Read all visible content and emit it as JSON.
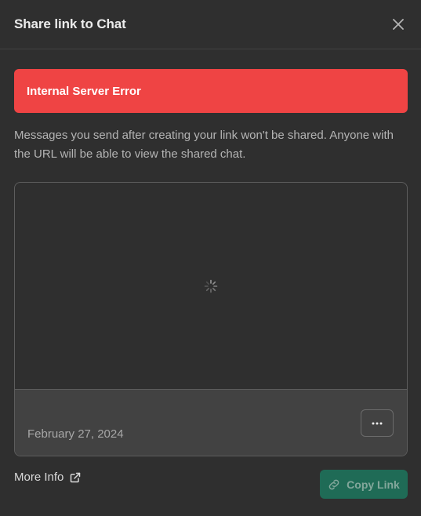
{
  "dialog": {
    "title": "Share link to Chat",
    "close_icon": "close-icon"
  },
  "error": {
    "message": "Internal Server Error",
    "color": "#ef4444"
  },
  "description": "Messages you send after creating your link won't be shared. Anyone with the URL will be able to view the shared chat.",
  "preview": {
    "loading_icon": "spinner-icon",
    "date": "February 27, 2024",
    "more_label": "···",
    "more_icon": "ellipsis-icon"
  },
  "footer": {
    "more_info_label": "More Info",
    "more_info_icon": "external-link-icon",
    "copy_link_label": "Copy Link",
    "copy_link_icon": "link-icon",
    "copy_link_color": "#1a7f64"
  }
}
